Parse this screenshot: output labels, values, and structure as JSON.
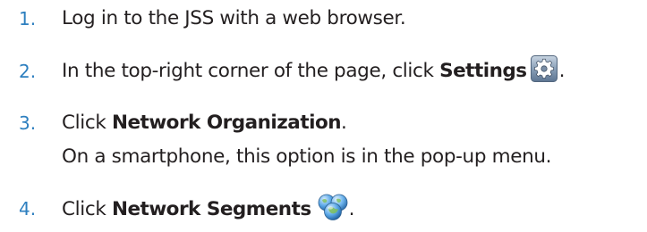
{
  "steps": [
    {
      "number": "1.",
      "text": "Log in to the JSS with a web browser."
    },
    {
      "number": "2.",
      "prefix": "In the top-right corner of the page, click ",
      "bold": "Settings",
      "suffix": ".",
      "icon": "settings-gear-icon"
    },
    {
      "number": "3.",
      "prefix": "Click ",
      "bold": "Network Organization",
      "suffix": ".",
      "note": "On a smartphone, this option is in the pop-up menu."
    },
    {
      "number": "4.",
      "prefix": "Click ",
      "bold": "Network Segments",
      "suffix": ".",
      "icon": "network-segments-globe-icon"
    }
  ],
  "colors": {
    "step_number": "#2d7fbf",
    "text": "#231f20",
    "gear_background": "#8aa0b8",
    "globe": "#3a8fd6"
  }
}
